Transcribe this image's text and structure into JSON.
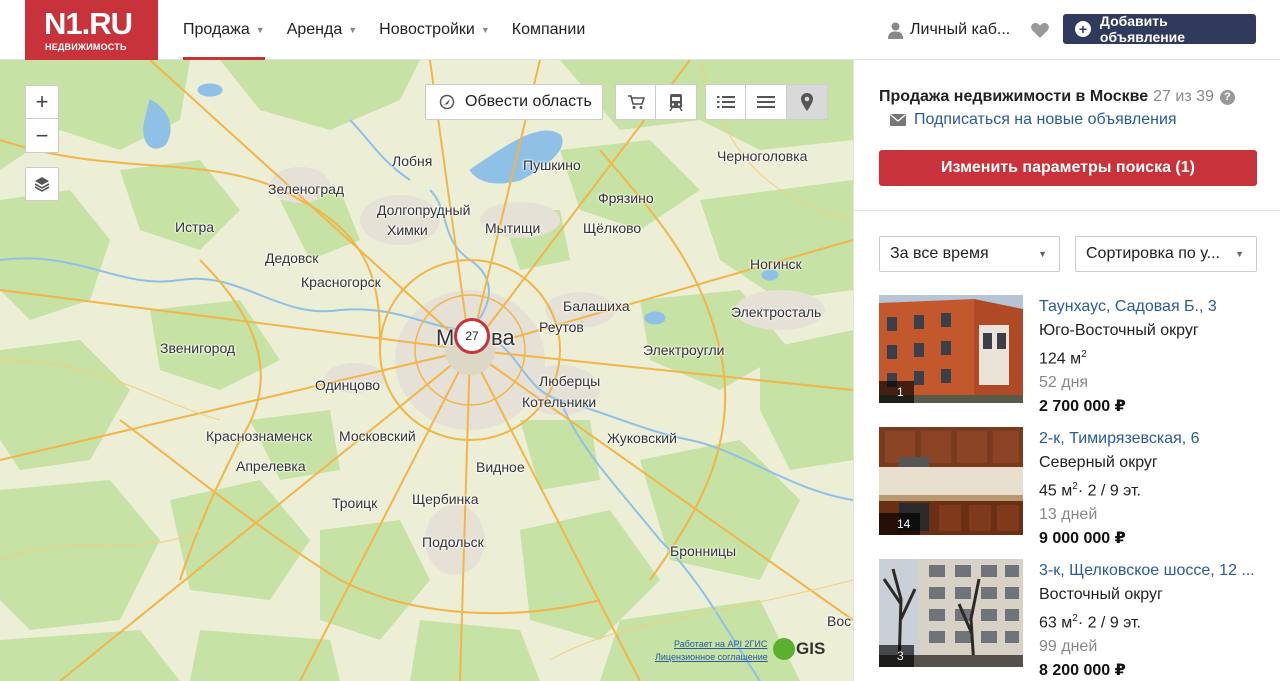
{
  "header": {
    "logo_main": "N1.RU",
    "logo_sub": "НЕДВИЖИМОСТЬ",
    "nav": [
      {
        "label": "Продажа",
        "dropdown": true,
        "active": true
      },
      {
        "label": "Аренда",
        "dropdown": true,
        "active": false
      },
      {
        "label": "Новостройки",
        "dropdown": true,
        "active": false
      },
      {
        "label": "Компании",
        "dropdown": false,
        "active": false
      }
    ],
    "cabinet_label": "Личный каб...",
    "add_button_label": "Добавить объявление",
    "brand_color": "#c8323a",
    "button_color": "#2f3a5c"
  },
  "map": {
    "zoom_in": "+",
    "zoom_out": "−",
    "area_button_label": "Обвести область",
    "cluster_count": "27",
    "cities": {
      "lobnya": "Лобня",
      "pushkino": "Пушкино",
      "chernogolovka": "Черноголовка",
      "zelenograd": "Зеленоград",
      "fryazino": "Фрязино",
      "dolgoprudny": "Долгопрудный",
      "istra": "Истра",
      "khimki": "Химки",
      "mytishchi": "Мытищи",
      "shchelkovo": "Щёлково",
      "dedovsk": "Дедовск",
      "noginsk": "Ногинск",
      "krasnogorsk": "Красногорск",
      "balashikha": "Балашиха",
      "elektrostal": "Электросталь",
      "reutov": "Реутов",
      "moscow_left": "Мо",
      "moscow_right": "ва",
      "zvenigorod": "Звенигород",
      "elektrougli": "Электроугли",
      "odintsovo": "Одинцово",
      "lyubertsy": "Люберцы",
      "kotelniki": "Котельники",
      "krasnoznamensk": "Краснознаменск",
      "moskovsky": "Московский",
      "zhukovsky": "Жуковский",
      "aprelevka": "Апрелевка",
      "vidnoe": "Видное",
      "troitsk": "Троицк",
      "shcherbinka": "Щербинка",
      "podolsk": "Подольск",
      "bronnitsy": "Бронницы",
      "vos": "Вос"
    },
    "credit_api": "Работает на API 2ГИС",
    "credit_license": "Лицензионное соглашение",
    "gis_logo": "GIS"
  },
  "panel": {
    "title": "Продажа недвижимости в Москве",
    "count": "27 из 39",
    "help": "?",
    "subscribe_label": "Подписаться на новые объявления",
    "change_button_label": "Изменить параметры поиска (1)",
    "filter_time": "За все время",
    "filter_sort": "Сортировка по у...",
    "listings": [
      {
        "title": "Таунхаус, Садовая Б., 3",
        "region": "Юго-Восточный округ",
        "area": "124 м",
        "area_sup": "2",
        "floor": "",
        "age": "52 дня",
        "price": "2 700 000 ₽",
        "photos": "1"
      },
      {
        "title": "2-к, Тимирязевская, 6",
        "region": "Северный округ",
        "area": "45 м",
        "area_sup": "2",
        "floor": "· 2 / 9 эт.",
        "age": "13 дней",
        "price": "9 000 000 ₽",
        "photos": "14"
      },
      {
        "title": "3-к, Щелковское шоссе, 12 ...",
        "region": "Восточный округ",
        "area": "63 м",
        "area_sup": "2",
        "floor": "· 2 / 9 эт.",
        "age": "99 дней",
        "price": "8 200 000 ₽",
        "photos": "3"
      }
    ]
  }
}
